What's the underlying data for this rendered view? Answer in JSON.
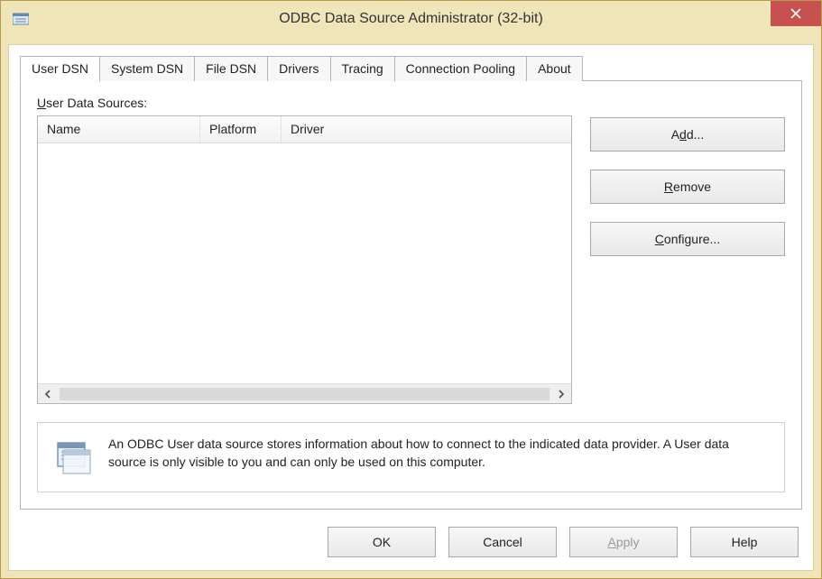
{
  "window": {
    "title": "ODBC Data Source Administrator (32-bit)"
  },
  "tabs": [
    {
      "label": "User DSN",
      "active": true
    },
    {
      "label": "System DSN",
      "active": false
    },
    {
      "label": "File DSN",
      "active": false
    },
    {
      "label": "Drivers",
      "active": false
    },
    {
      "label": "Tracing",
      "active": false
    },
    {
      "label": "Connection Pooling",
      "active": false
    },
    {
      "label": "About",
      "active": false
    }
  ],
  "panel": {
    "subtitle_pre": "U",
    "subtitle_rest": "ser Data Sources:",
    "columns": {
      "name": "Name",
      "platform": "Platform",
      "driver": "Driver"
    },
    "rows": []
  },
  "side_buttons": {
    "add_pre": "A",
    "add_ul": "d",
    "add_post": "d...",
    "remove_ul": "R",
    "remove_post": "emove",
    "configure_ul": "C",
    "configure_post": "onfigure..."
  },
  "info": {
    "text": "An ODBC User data source stores information about how to connect to the indicated data provider.   A User data source is only visible to you and can only be used on this computer."
  },
  "buttons": {
    "ok": "OK",
    "cancel": "Cancel",
    "apply_ul": "A",
    "apply_post": "pply",
    "help": "Help"
  }
}
